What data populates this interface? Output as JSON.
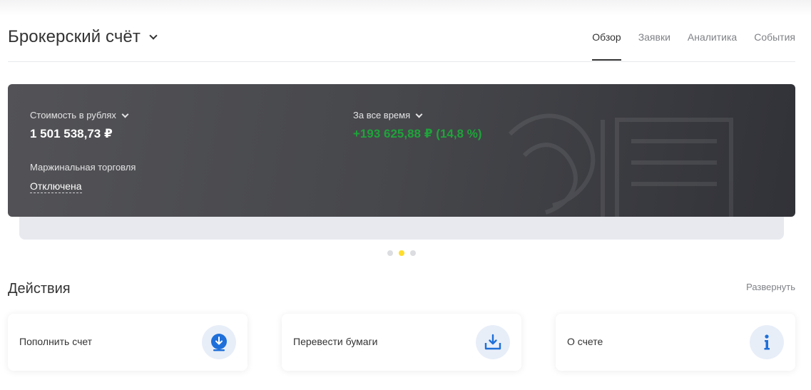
{
  "header": {
    "account_title": "Брокерский счёт",
    "tabs": [
      {
        "label": "Обзор",
        "active": true
      },
      {
        "label": "Заявки",
        "active": false
      },
      {
        "label": "Аналитика",
        "active": false
      },
      {
        "label": "События",
        "active": false
      }
    ]
  },
  "summary_card": {
    "value_label": "Стоимость в рублях",
    "value": "1 501 538,73 ₽",
    "period_label": "За все время",
    "profit": "+193 625,88 ₽ (14,8 %)",
    "margin_label": "Маржинальная торговля",
    "margin_status": "Отключена",
    "profit_color": "#1fa33a"
  },
  "carousel": {
    "total": 3,
    "active_index": 1,
    "active_color": "#ffdd2d"
  },
  "actions": {
    "title": "Действия",
    "expand_label": "Развернуть",
    "items": [
      {
        "label": "Пополнить счет",
        "icon": "deposit-icon"
      },
      {
        "label": "Перевести бумаги",
        "icon": "transfer-securities-icon"
      },
      {
        "label": "О счете",
        "icon": "info-icon"
      }
    ]
  },
  "accent_color": "#1e6fd9"
}
